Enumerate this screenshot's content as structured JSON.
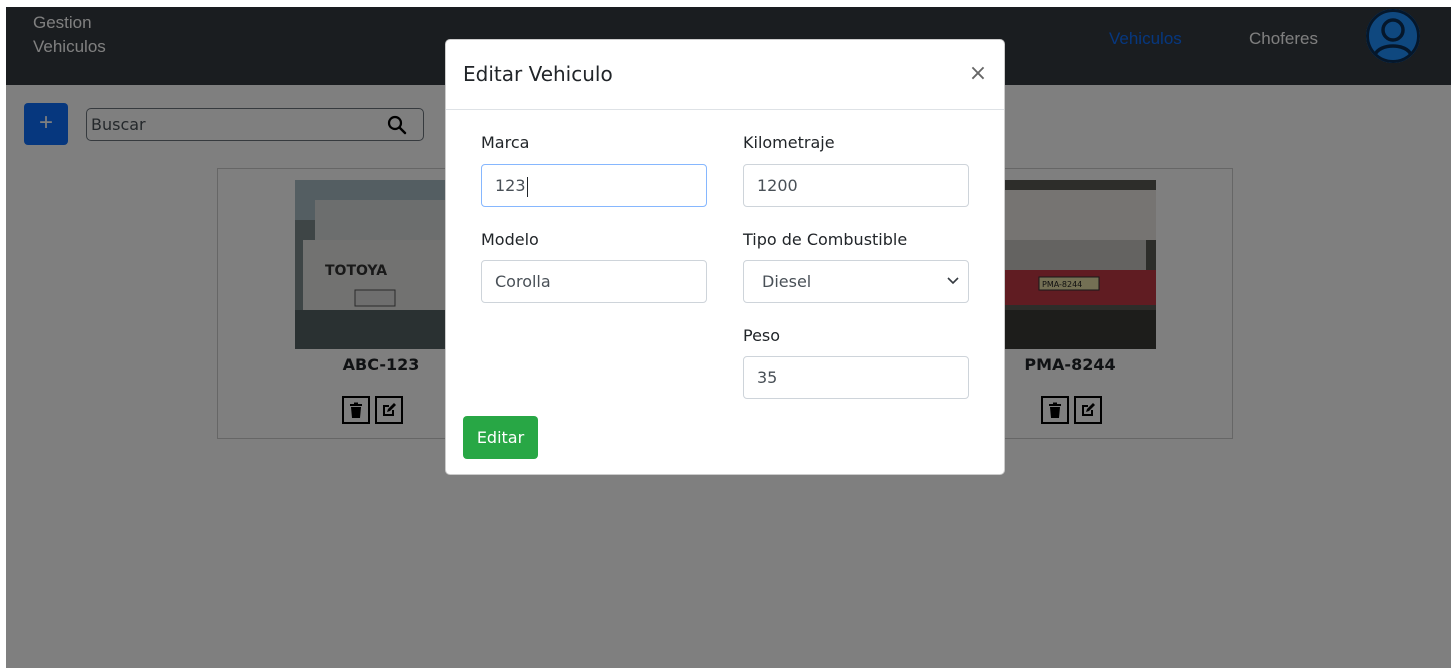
{
  "navbar": {
    "brand_line1": "Gestion",
    "brand_line2": "Vehiculos",
    "nav_vehiculos": "Vehiculos",
    "nav_choferes": "Choferes",
    "active_color": "#0d6efd"
  },
  "toolbar": {
    "add_label": "+",
    "search_placeholder": "Buscar"
  },
  "cards": [
    {
      "plate": "ABC-123",
      "image_label": "TOTOYA"
    },
    {
      "plate": "PMA-8244",
      "image_label": "PMA-8244"
    }
  ],
  "modal": {
    "title": "Editar Vehiculo",
    "close_label": "×",
    "fields": {
      "marca": {
        "label": "Marca",
        "value": "123"
      },
      "kilometraje": {
        "label": "Kilometraje",
        "value": "1200"
      },
      "modelo": {
        "label": "Modelo",
        "value": "Corolla"
      },
      "combustible": {
        "label": "Tipo de Combustible",
        "value": "Diesel"
      },
      "peso": {
        "label": "Peso",
        "value": "35"
      }
    },
    "submit_label": "Editar",
    "submit_color": "#28a745"
  },
  "icons": {
    "search": "search-icon",
    "delete": "trash-icon",
    "edit": "edit-icon",
    "user": "user-icon",
    "close": "close-icon",
    "chevron": "chevron-down-icon"
  }
}
